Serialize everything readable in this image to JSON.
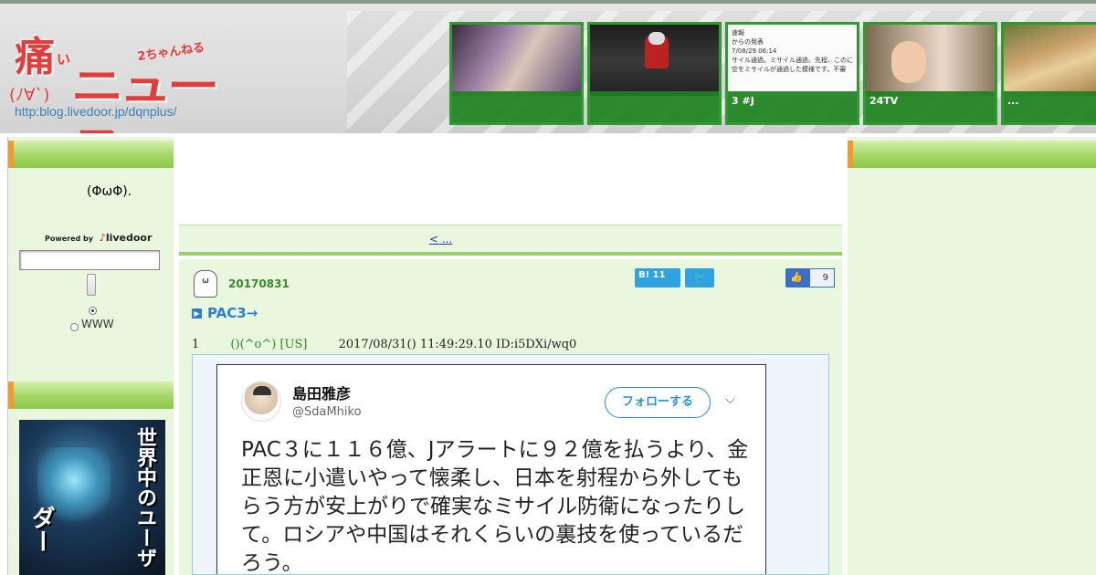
{
  "header": {
    "logo": {
      "kanji": "痛",
      "small_i": "い",
      "chan": "ちゃんねる",
      "news": "ニュース",
      "face": "(ﾉ∀`)",
      "two": "2",
      "url": "http:blog.livedoor.jp/dqnplus/"
    },
    "thumbs": [
      {
        "caption": ""
      },
      {
        "caption": ""
      },
      {
        "caption": "3 #J",
        "img_text": "速報\nからの発表\n7/08/29 06:14\nサイル通過。ミサイル通過。先程、このに\n空をミサイルが通過した模様です。不審"
      },
      {
        "caption": "24TV"
      },
      {
        "caption": "..."
      }
    ]
  },
  "sidebar": {
    "face_icon": "(ΦωΦ).",
    "powered_by": "Powered by",
    "brand": "livedoor",
    "search_value": "",
    "radio_www": "WWW",
    "banner_text_1": "世界中のユーザ",
    "banner_text_2": "ダー"
  },
  "center": {
    "nav_link": "<  ...      ",
    "article": {
      "date": "20170831",
      "title": "PAC3→",
      "hatena_label": "B! 11",
      "like_count": "9",
      "res_number": "1",
      "res_name": "()(^o^) [US]",
      "res_datetime": "2017/08/31() 11:49:29.10 ID:i5DXi/wq0"
    },
    "tweet": {
      "name": "島田雅彦",
      "handle": "@SdaMhiko",
      "follow_label": "フォローする",
      "body": "PAC３に１１６億、Jアラートに９２億を払うより、金正恩に小遣いやって懐柔し、日本を射程から外してもらう方が安上がりで確実なミサイル防衛になったりして。ロシアや中国はそれくらいの裏技を使っているだろう。"
    }
  },
  "colors": {
    "accent_green": "#2f9a2f",
    "bar_orange": "#f39a2a",
    "link_blue": "#2a7fd0",
    "bg_green": "#e8f7de"
  }
}
